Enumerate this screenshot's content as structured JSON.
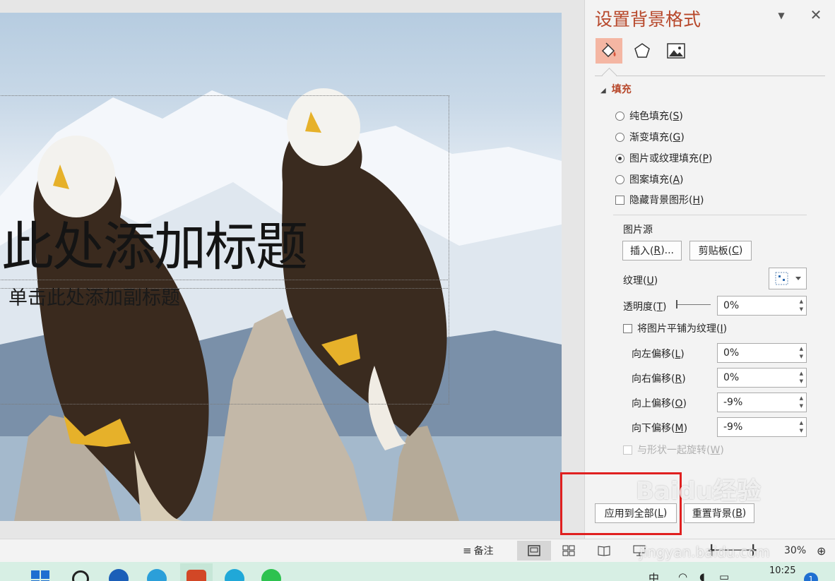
{
  "slide": {
    "title": "此处添加标题",
    "subtitle": "单击此处添加副标题"
  },
  "pane": {
    "title": "设置背景格式",
    "tabs": [
      "fill-icon",
      "pentagon-icon",
      "picture-icon"
    ],
    "section": "填充",
    "fill_options": [
      {
        "label": "纯色填充(",
        "key": "S",
        "end": ")",
        "selected": false
      },
      {
        "label": "渐变填充(",
        "key": "G",
        "end": ")",
        "selected": false
      },
      {
        "label": "图片或纹理填充(",
        "key": "P",
        "end": ")",
        "selected": true
      },
      {
        "label": "图案填充(",
        "key": "A",
        "end": ")",
        "selected": false
      }
    ],
    "hide_bg": {
      "label": "隐藏背景图形(",
      "key": "H",
      "end": ")"
    },
    "picture_source_label": "图片源",
    "insert_btn": {
      "label": "插入(",
      "key": "R",
      "end": ")..."
    },
    "clipboard_btn": {
      "label": "剪贴板(",
      "key": "C",
      "end": ")"
    },
    "texture": {
      "label": "纹理(",
      "key": "U",
      "end": ")"
    },
    "transparency": {
      "label": "透明度(",
      "key": "T",
      "end": ")",
      "value": "0%"
    },
    "tile": {
      "label": "将图片平铺为纹理(",
      "key": "I",
      "end": ")"
    },
    "offsets": [
      {
        "label": "向左偏移(",
        "key": "L",
        "end": ")",
        "value": "0%"
      },
      {
        "label": "向右偏移(",
        "key": "R",
        "end": ")",
        "value": "0%"
      },
      {
        "label": "向上偏移(",
        "key": "O",
        "end": ")",
        "value": "-9%"
      },
      {
        "label": "向下偏移(",
        "key": "M",
        "end": ")",
        "value": "-9%"
      }
    ],
    "rotate": {
      "label": "与形状一起旋转(",
      "key": "W",
      "end": ")"
    },
    "apply_all_btn": {
      "label": "应用到全部(",
      "key": "L",
      "end": ")"
    },
    "reset_btn": {
      "label": "重置背景(",
      "key": "B",
      "end": ")"
    }
  },
  "statusbar": {
    "notes": "备注",
    "zoom": "30%"
  },
  "taskbar": {
    "time": "10:25",
    "ime": "中",
    "badge": "1"
  },
  "watermark": {
    "main": "Baidu经验",
    "sub": "jingyan.baidu.com"
  },
  "colors": {
    "accent": "#b7472a",
    "tab_selected": "#f4b6a3",
    "highlight": "#e02020"
  }
}
